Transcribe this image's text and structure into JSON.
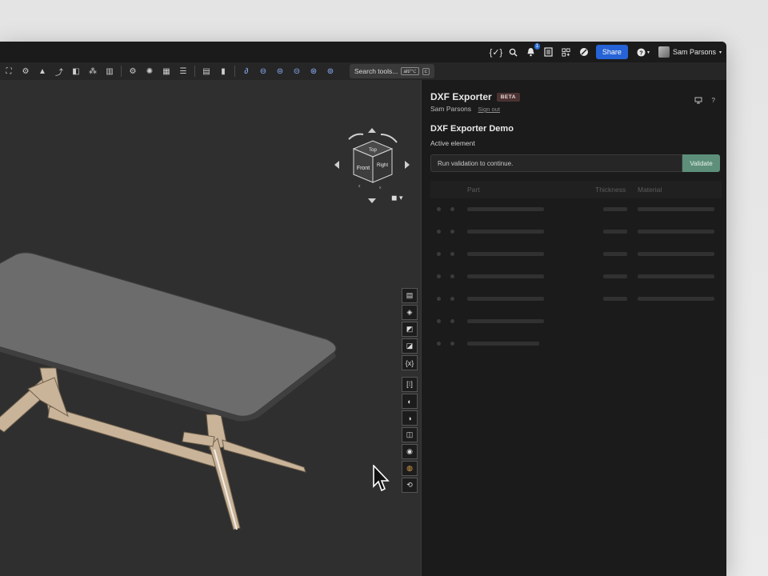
{
  "topbar": {
    "notification_count": "1",
    "share_label": "Share",
    "help_icon": "?",
    "user_name": "Sam Parsons",
    "icons": [
      "variables-icon",
      "search-icon",
      "bell-icon",
      "document-icon",
      "apps-icon",
      "globe-icon",
      "help-icon"
    ]
  },
  "toolbar": {
    "search_label": "Search tools...",
    "shortcut_keys": "alt/⌥",
    "shortcut_letter": "c"
  },
  "viewcube": {
    "top": "Top",
    "front": "Front",
    "right": "Right",
    "axis_x": "x",
    "axis_z": "z"
  },
  "panel": {
    "title": "DXF Exporter",
    "badge": "BETA",
    "user": "Sam Parsons",
    "sign_out": "Sign out",
    "demo_title": "DXF Exporter Demo",
    "active_element": "Active element",
    "validation_message": "Run validation to continue.",
    "validate_label": "Validate",
    "table": {
      "columns": [
        "Part",
        "Thickness",
        "Material"
      ],
      "row_count": 7
    }
  },
  "colors": {
    "accent_blue": "#2563d6",
    "validate_green": "#5d8f7a",
    "beta_bg": "#4b3232",
    "table_top": "#6c6c6c",
    "table_legs": "#c9b49a"
  }
}
